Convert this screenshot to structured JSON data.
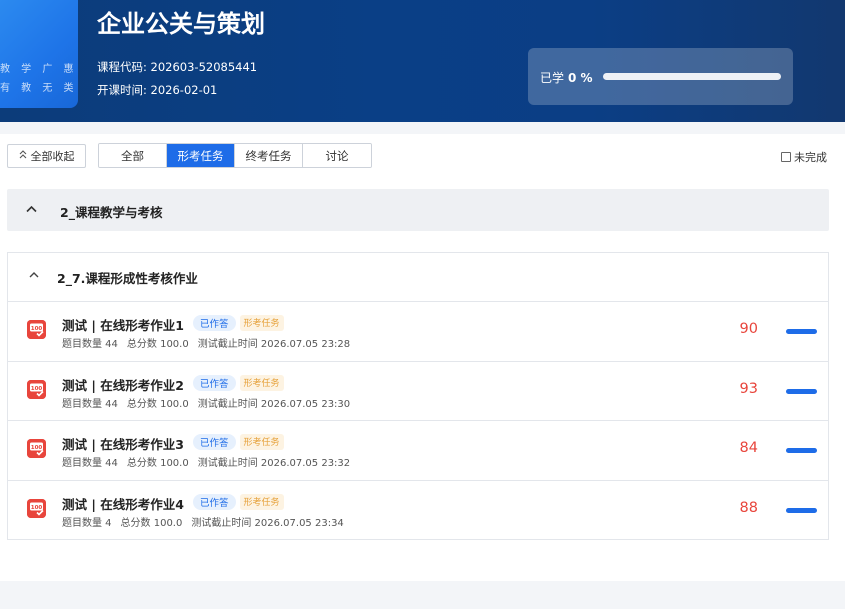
{
  "banner": {
    "cover_line1": "教 学 广 惠",
    "cover_line2": "有 教 无 类",
    "title": "企业公关与策划",
    "course_code": "课程代码: 202603-52085441",
    "start_time": "开课时间: 2026-02-01",
    "progress_label": "已学",
    "progress_value": "0 %",
    "progress_fraction": 0.0
  },
  "toolbar": {
    "collapse_all": "全部收起",
    "tabs": [
      {
        "label": "全部",
        "active": false
      },
      {
        "label": "形考任务",
        "active": true
      },
      {
        "label": "终考任务",
        "active": false
      },
      {
        "label": "讨论",
        "active": false
      }
    ],
    "filter_label": "未完成"
  },
  "section": {
    "title": "2_课程教学与考核",
    "subsection": {
      "title": "2_7.课程形成性考核作业",
      "tasks": [
        {
          "title": "测试 | 在线形考作业1",
          "status": "已作答",
          "type": "形考任务",
          "count": "题目数量 44",
          "total": "总分数 100.0",
          "deadline": "测试截止时间 2026.07.05 23:28",
          "score": "90"
        },
        {
          "title": "测试 | 在线形考作业2",
          "status": "已作答",
          "type": "形考任务",
          "count": "题目数量 44",
          "total": "总分数 100.0",
          "deadline": "测试截止时间 2026.07.05 23:30",
          "score": "93"
        },
        {
          "title": "测试 | 在线形考作业3",
          "status": "已作答",
          "type": "形考任务",
          "count": "题目数量 44",
          "total": "总分数 100.0",
          "deadline": "测试截止时间 2026.07.05 23:32",
          "score": "84"
        },
        {
          "title": "测试 | 在线形考作业4",
          "status": "已作答",
          "type": "形考任务",
          "count": "题目数量 4",
          "total": "总分数 100.0",
          "deadline": "测试截止时间 2026.07.05 23:34",
          "score": "88"
        }
      ]
    }
  },
  "colors": {
    "accent": "#1e6ce8",
    "score": "#e8453c",
    "banner": "#0b3e85",
    "badge_type": "#e6a23c"
  }
}
